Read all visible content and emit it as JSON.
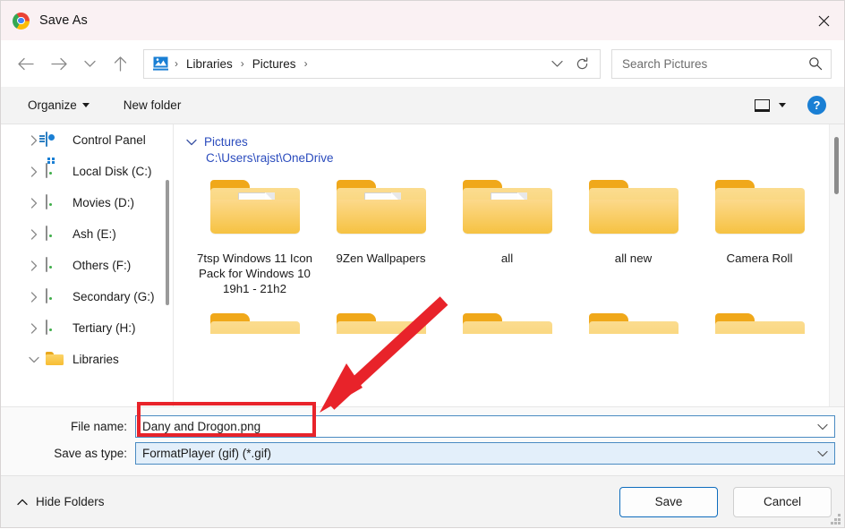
{
  "window": {
    "title": "Save As",
    "app_icon": "chrome-logo",
    "close_label": "✕"
  },
  "navbar": {
    "back_icon": "arrow-left-icon",
    "forward_icon": "arrow-right-icon",
    "recent_icon": "chevron-down-icon",
    "up_icon": "arrow-up-icon",
    "address": {
      "icon": "pictures-library-icon",
      "crumbs": [
        "Libraries",
        "Pictures"
      ],
      "separator": "›",
      "history_icon": "chevron-down-icon",
      "refresh_icon": "refresh-icon"
    },
    "search": {
      "placeholder": "Search Pictures",
      "value": "",
      "icon": "search-icon"
    }
  },
  "commandbar": {
    "organize_label": "Organize",
    "new_folder_label": "New folder",
    "view_icon": "view-layout-icon",
    "view_chevron": "chevron-down-icon",
    "help_label": "?"
  },
  "sidebar": {
    "items": [
      {
        "label": "Control Panel",
        "icon": "control-panel-icon",
        "expanded": false
      },
      {
        "label": "Local Disk (C:)",
        "icon": "system-drive-icon",
        "expanded": false
      },
      {
        "label": "Movies (D:)",
        "icon": "drive-icon",
        "expanded": false
      },
      {
        "label": "Ash (E:)",
        "icon": "drive-icon",
        "expanded": false
      },
      {
        "label": "Others (F:)",
        "icon": "drive-icon",
        "expanded": false
      },
      {
        "label": "Secondary (G:)",
        "icon": "drive-icon",
        "expanded": false
      },
      {
        "label": "Tertiary (H:)",
        "icon": "drive-icon",
        "expanded": false
      },
      {
        "label": "Libraries",
        "icon": "library-folder-icon",
        "expanded": true
      }
    ]
  },
  "content": {
    "group_title": "Pictures",
    "group_path": "C:\\Users\\rajst\\OneDrive",
    "folders": [
      {
        "name": "7tsp Windows 11 Icon Pack for Windows 10 19h1 - 21h2",
        "thumb": "image"
      },
      {
        "name": "9Zen Wallpapers",
        "thumb": "document"
      },
      {
        "name": "all",
        "thumb": "spreadsheet"
      },
      {
        "name": "all new",
        "thumb": "none"
      },
      {
        "name": "Camera Roll",
        "thumb": "none"
      }
    ]
  },
  "fields": {
    "file_name_label": "File name:",
    "file_name_value": "Dany and Drogon.png",
    "save_as_type_label": "Save as type:",
    "save_as_type_value": "FormatPlayer (gif) (*.gif)",
    "dropdown_icon": "chevron-down-icon"
  },
  "footer": {
    "hide_folders_label": "Hide Folders",
    "hide_folders_icon": "chevron-up-icon",
    "save_label": "Save",
    "cancel_label": "Cancel",
    "resize_grip_icon": "resize-grip-icon"
  },
  "annotations": {
    "highlight_color": "#e8232a",
    "arrow_color": "#e8232a",
    "highlight_target": "file-name-input",
    "arrow_target": "file-name-input"
  }
}
